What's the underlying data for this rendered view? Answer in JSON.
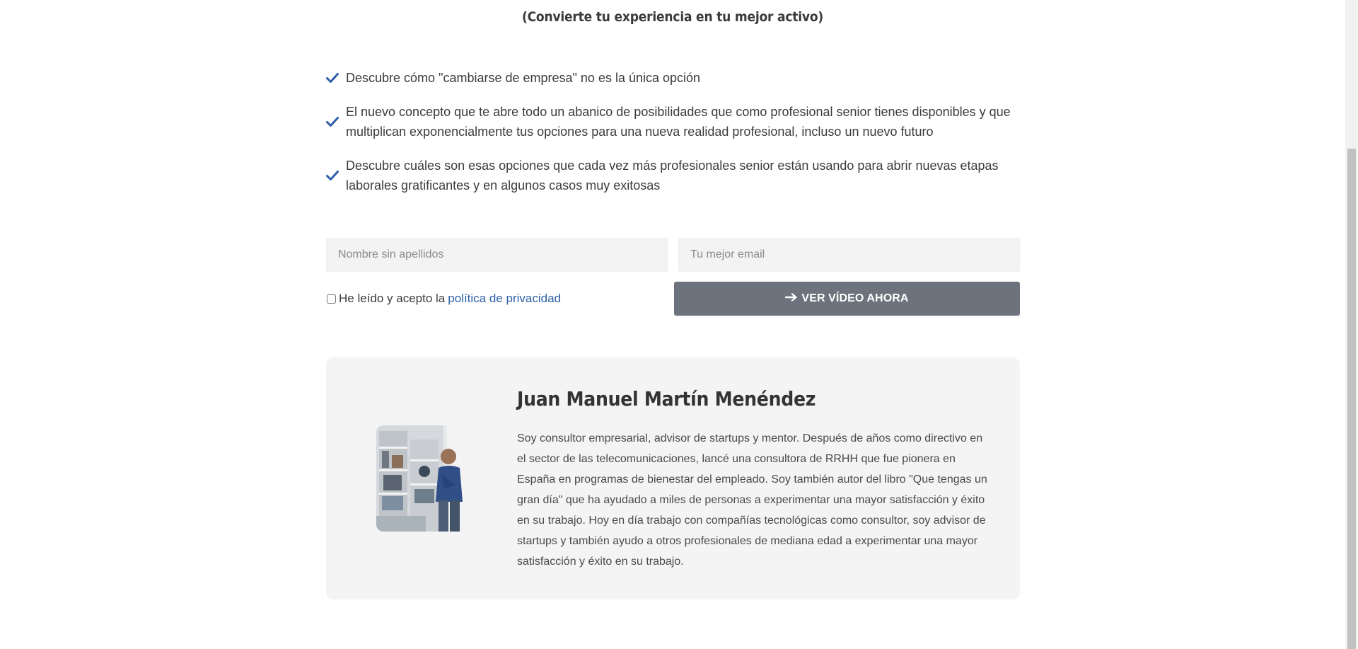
{
  "subtitle": "(Convierte tu experiencia en tu mejor activo)",
  "benefits": [
    {
      "text": "Descubre cómo \"cambiarse de empresa\" no es la única opción"
    },
    {
      "text": "El nuevo concepto que te abre todo un abanico de posibilidades que como profesional senior tienes disponibles y que multiplican exponencialmente tus opciones para una nueva realidad profesional, incluso un nuevo futuro"
    },
    {
      "text": "Descubre cuáles son esas opciones que cada vez más profesionales senior están usando para abrir nuevas etapas laborales gratificantes y en algunos casos muy exitosas"
    }
  ],
  "form": {
    "name_placeholder": "Nombre sin apellidos",
    "email_placeholder": "Tu mejor email",
    "consent_text": "He leído y acepto la",
    "privacy_link": "política de privacidad",
    "submit_icon": "arrow-right-icon",
    "submit_label": "VER VÍDEO AHORA"
  },
  "bio": {
    "name": "Juan Manuel Martín Menéndez",
    "text": "Soy consultor empresarial, advisor de startups y mentor. Después de años como directivo en el sector de las telecomunicaciones, lancé una consultora de RRHH que fue pionera en España en programas de bienestar del empleado. Soy también autor del libro \"Que tengas un gran día\" que ha ayudado a miles de personas a experimentar una mayor satisfacción y éxito en su trabajo. Hoy en día trabajo con compañías tecnológicas como consultor, soy advisor de startups y también ayudo a otros profesionales de mediana edad a experimentar una mayor satisfacción y éxito en su trabajo."
  },
  "colors": {
    "check": "#2d5fa8",
    "button": "#6c737c",
    "link": "#2d5fa8",
    "card": "#f4f4f4"
  }
}
